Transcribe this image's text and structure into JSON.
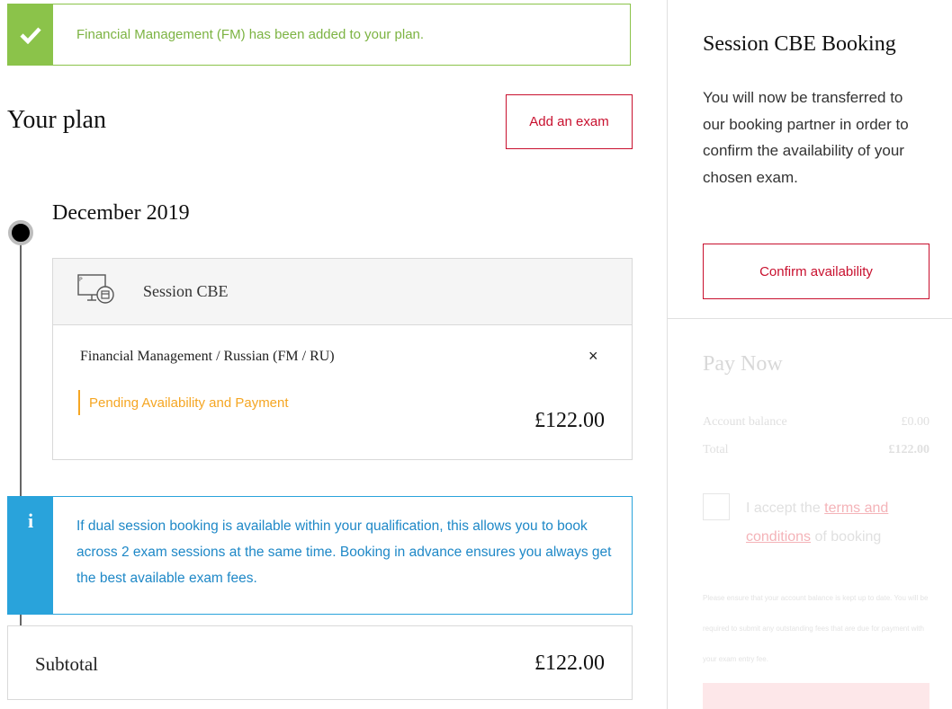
{
  "banner": {
    "message": "Financial Management (FM) has been added to your plan."
  },
  "plan": {
    "title": "Your plan",
    "add_exam_label": "Add an exam",
    "month": "December 2019"
  },
  "card": {
    "session_label": "Session CBE",
    "exam_name": "Financial Management / Russian (FM / RU)",
    "remove_symbol": "×",
    "status": "Pending Availability and Payment",
    "price": "£122.00"
  },
  "info": {
    "icon_letter": "i",
    "text": "If dual session booking is available within your qualification, this allows you to book across 2 exam sessions at the same time. Booking in advance ensures you always get the best available exam fees."
  },
  "subtotal": {
    "label": "Subtotal",
    "amount": "£122.00"
  },
  "sidebar": {
    "title": "Session CBE Booking",
    "text": "You will now be transferred to our booking partner in order to confirm the availability of your chosen exam.",
    "confirm_label": "Confirm availability",
    "pay_title": "Pay Now",
    "account_balance_label": "Account balance",
    "account_balance_value": "£0.00",
    "total_label": "Total",
    "total_value": "£122.00",
    "accept_prefix": "I accept the ",
    "accept_link": "terms and conditions",
    "accept_suffix": " of booking",
    "fine_print": "Please ensure that your account balance is kept up to date. You will be required to submit any outstanding fees that are due for payment with your exam entry fee."
  },
  "colors": {
    "success": "#8bc34a",
    "brand_red": "#c8102e",
    "info_blue": "#29a3db",
    "pending_orange": "#f5a623"
  }
}
